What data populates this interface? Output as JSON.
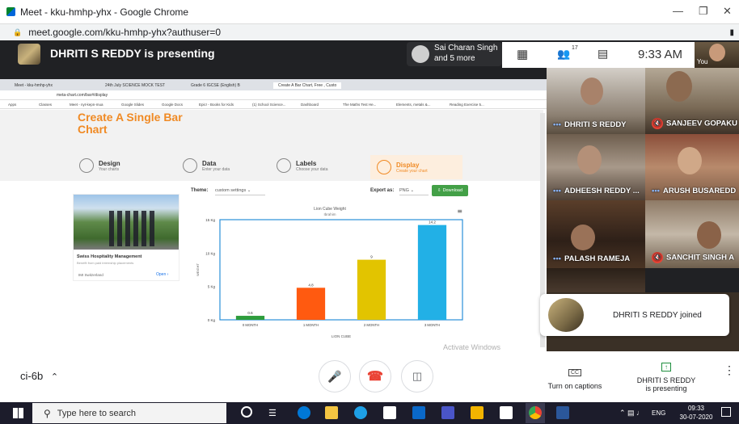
{
  "window": {
    "title": "Meet - kku-hmhp-yhx - Google Chrome",
    "url": "meet.google.com/kku-hmhp-yhx?authuser=0"
  },
  "meet": {
    "presenter_text": "DHRITI S REDDY is presenting",
    "others_line1": "Sai Charan Singh",
    "others_line2": "and 5 more",
    "participant_count": "17",
    "time": "9:33 AM",
    "self_label": "You",
    "meeting_code": "ci-6b",
    "captions_label": "Turn on captions",
    "present_line1": "DHRITI S REDDY",
    "present_line2": "is presenting",
    "toast": "DHRITI S REDDY joined"
  },
  "participants": [
    {
      "name": "DHRITI S REDDY",
      "muted": false
    },
    {
      "name": "SANJEEV GOPAKU",
      "muted": true
    },
    {
      "name": "ADHEESH REDDY ...",
      "muted": false
    },
    {
      "name": "ARUSH BUSAREDD",
      "muted": false
    },
    {
      "name": "PALASH RAMEJA",
      "muted": false
    },
    {
      "name": "SANCHIT SINGH A",
      "muted": true
    }
  ],
  "inner_browser": {
    "tabs": [
      "Meet - kku-hmhp-yhx",
      "24th July SCIENCE MOCK TEST",
      "Grade 6 IGCSE (English) B",
      "Create A Bar Chart, Free , Custo"
    ],
    "url": "meta-chart.com/bar#/display",
    "bookmarks": [
      "Apps",
      "Classes",
      "Meet - nyt-kepn-mua",
      "Google Slides",
      "Google Docs",
      "Epic! - Books for Kids",
      "(1) School Science...",
      "Dashboard",
      "The Maths Test He...",
      "Elements, metals &...",
      "Reading Exercise 5..."
    ]
  },
  "metachart": {
    "page_heading": "Create A Single Bar Chart",
    "steps": [
      {
        "title": "Design",
        "sub": "Your charts"
      },
      {
        "title": "Data",
        "sub": "Enter your data"
      },
      {
        "title": "Labels",
        "sub": "Choose your data"
      },
      {
        "title": "Display",
        "sub": "Create your chart"
      }
    ],
    "theme_label": "Theme:",
    "theme_value": "custom settings",
    "export_label": "Export as:",
    "export_value": "PNG",
    "download_label": "Download",
    "ad_title": "Swiss Hospitality Management",
    "ad_desc": "Benefit from paid internship placements",
    "ad_source": "IMI Switzerland",
    "ad_open": "Open",
    "activate_text": "Activate Windows"
  },
  "chart_data": {
    "type": "bar",
    "title": "Lion Cube Weight",
    "subtitle": "Ibrahim",
    "categories": [
      "0 MONTH",
      "1 MONTH",
      "2 MONTH",
      "3 MONTH"
    ],
    "values": [
      0.6,
      4.8,
      9,
      14.2
    ],
    "value_labels": [
      "0.6",
      "4.8",
      "9",
      "14.2"
    ],
    "colors": [
      "#2e9d3c",
      "#ff5a10",
      "#e2c400",
      "#22b0e6"
    ],
    "xlabel": "LION CUBE",
    "ylabel": "WEIGHT",
    "yticks": [
      0,
      5,
      10,
      15
    ],
    "ytick_labels": [
      "0 Kg",
      "5 Kg",
      "10 Kg",
      "15 Kg"
    ],
    "ylim": [
      0,
      15
    ],
    "grid": false,
    "legend": "none"
  },
  "taskbar": {
    "search_placeholder": "Type here to search",
    "lang": "ENG",
    "clock_time": "09:33",
    "clock_date": "30-07-2020"
  }
}
